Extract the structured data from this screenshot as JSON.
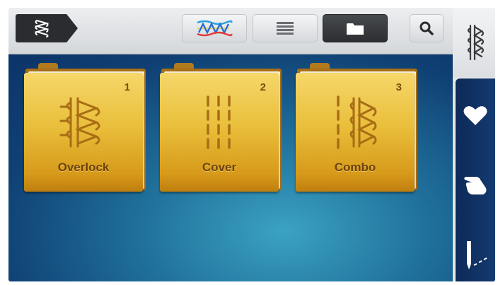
{
  "toolbar": {
    "home_icon": "stitch-menu-icon",
    "buttons": [
      {
        "name": "stitch-view",
        "icon": "colored-stitch-icon",
        "active": false
      },
      {
        "name": "list-view",
        "icon": "list-icon",
        "active": false
      },
      {
        "name": "folder-view",
        "icon": "folder-icon",
        "active": true
      },
      {
        "name": "search",
        "icon": "search-icon",
        "active": false
      }
    ]
  },
  "folders": [
    {
      "number": "1",
      "label": "Overlock",
      "icon": "overlock-stitch-icon"
    },
    {
      "number": "2",
      "label": "Cover",
      "icon": "cover-stitch-icon"
    },
    {
      "number": "3",
      "label": "Combo",
      "icon": "combo-stitch-icon"
    }
  ],
  "sidebar": {
    "items": [
      {
        "name": "stitches",
        "icon": "stitch-icon",
        "active": true
      },
      {
        "name": "favorites",
        "icon": "heart-icon"
      },
      {
        "name": "personal",
        "icon": "hand-icon"
      },
      {
        "name": "needle",
        "icon": "needle-icon"
      }
    ]
  },
  "colors": {
    "accent_dark": "#2c2e31",
    "folder_gold": "#e9bf3b",
    "background_blue": "#1f6f9a",
    "sidebar_navy": "#0d2a57"
  }
}
